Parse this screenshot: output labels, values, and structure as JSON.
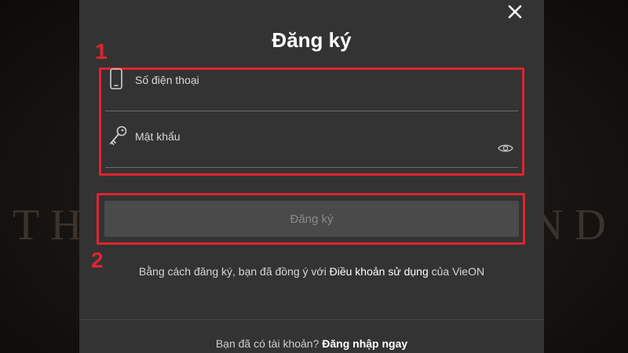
{
  "background": {
    "left_letters": "THI",
    "right_letters": "ND"
  },
  "modal": {
    "title": "Đăng ký",
    "phone_field": {
      "placeholder": "Số điện thoại"
    },
    "password_field": {
      "placeholder": "Mật khẩu"
    },
    "submit_label": "Đăng ký",
    "terms": {
      "prefix": "Bằng cách đăng ký, bạn đã đồng ý với ",
      "link": "Điều khoản sử dụng",
      "suffix": " của VieON"
    },
    "login": {
      "prompt": "Bạn đã có tài khoản? ",
      "link": "Đăng nhập ngay"
    }
  },
  "annotations": {
    "label_1": "1",
    "label_2": "2",
    "color": "#e0242f"
  },
  "icons": {
    "close": "close-icon",
    "phone": "phone-icon",
    "key": "key-icon",
    "eye": "eye-icon"
  },
  "colors": {
    "modal_bg": "#333333",
    "button_bg": "#4a4a4a",
    "text": "#ffffff"
  }
}
